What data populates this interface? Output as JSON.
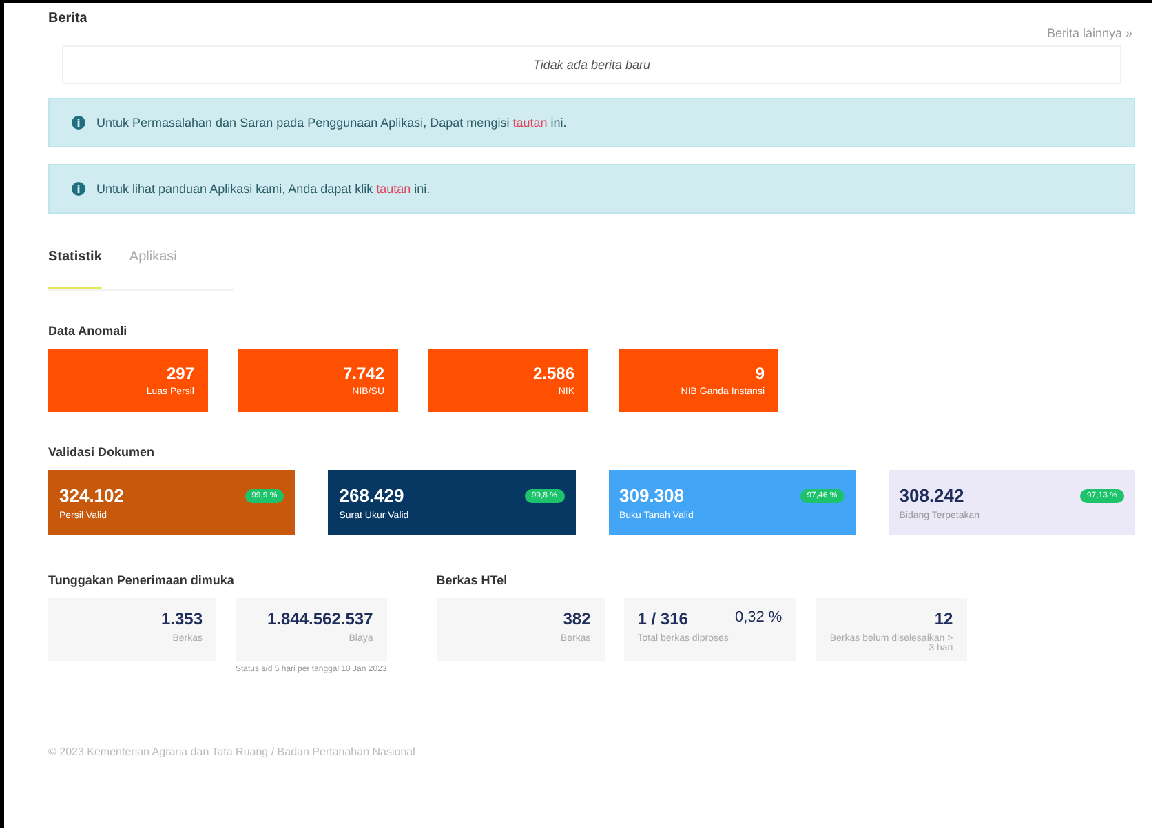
{
  "news": {
    "title": "Berita",
    "more_link": "Berita lainnya »",
    "empty_message": "Tidak ada berita baru"
  },
  "alerts": [
    {
      "text": "Untuk Permasalahan dan Saran pada Penggunaan Aplikasi, Dapat mengisi ",
      "link": "tautan",
      "after": " ini."
    },
    {
      "text": "Untuk lihat panduan Aplikasi kami, Anda dapat klik ",
      "link": "tautan",
      "after": " ini."
    }
  ],
  "tabs": [
    {
      "label": "Statistik",
      "selected": true
    },
    {
      "label": "Aplikasi",
      "selected": false
    }
  ],
  "anomaly": {
    "title": "Data Anomali",
    "cards": [
      {
        "value": "297",
        "label": "Luas Persil"
      },
      {
        "value": "7.742",
        "label": "NIB/SU"
      },
      {
        "value": "2.586",
        "label": "NIK"
      },
      {
        "value": "9",
        "label": "NIB Ganda Instansi"
      }
    ]
  },
  "validation": {
    "title": "Validasi Dokumen",
    "cards": [
      {
        "value": "324.102",
        "label": "Persil Valid",
        "badge": "99,9 %",
        "color": "#c8590c"
      },
      {
        "value": "268.429",
        "label": "Surat Ukur Valid",
        "badge": "99,8 %",
        "color": "#073763"
      },
      {
        "value": "309.308",
        "label": "Buku Tanah Valid",
        "badge": "97,46 %",
        "color": "#42a5f5"
      },
      {
        "value": "308.242",
        "label": "Bidang Terpetakan",
        "badge": "97,13 %",
        "color": "#ebe9f8"
      }
    ]
  },
  "arrears": {
    "title": "Tunggakan Penerimaan dimuka",
    "boxes": [
      {
        "value": "1.353",
        "label": "Berkas"
      },
      {
        "value": "1.844.562.537",
        "label": "Biaya"
      }
    ],
    "note": "Status s/d 5 hari per tanggal 10 Jan 2023"
  },
  "htel": {
    "title": "Berkas HTel",
    "boxes": [
      {
        "value": "382",
        "label": "Berkas"
      },
      {
        "value": "1 / 316",
        "extra": "0,32 %",
        "label": "Total berkas diproses"
      },
      {
        "value": "12",
        "label": "Berkas belum diselesaikan > 3 hari"
      }
    ]
  },
  "footer": "© 2023 Kementerian Agraria dan Tata Ruang / Badan Pertanahan Nasional"
}
